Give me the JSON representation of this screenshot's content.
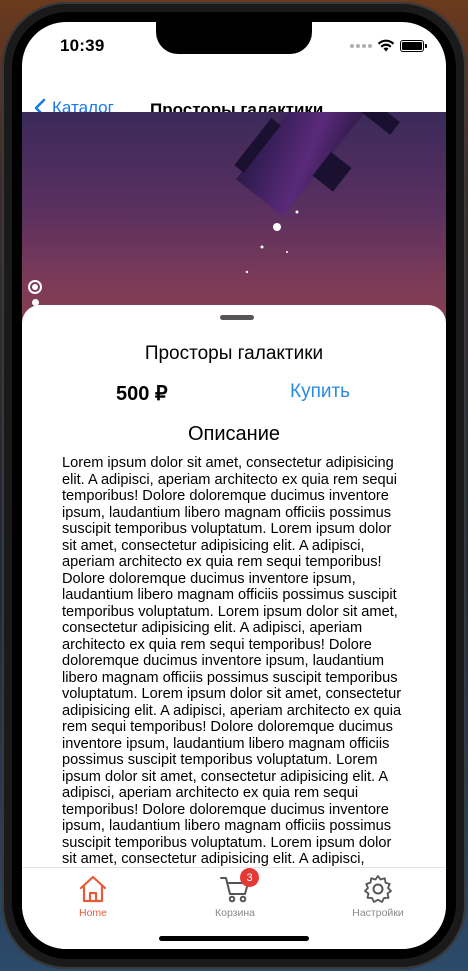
{
  "status": {
    "time": "10:39"
  },
  "nav": {
    "back_label": "Каталог",
    "title": "Просторы галактики"
  },
  "product": {
    "title": "Просторы галактики",
    "price": "500 ₽",
    "buy_label": "Купить",
    "description_heading": "Описание",
    "description": "Lorem ipsum dolor sit amet, consectetur adipisicing elit. A adipisci, aperiam architecto ex quia rem sequi temporibus! Dolore doloremque ducimus inventore ipsum, laudantium libero magnam officiis possimus suscipit temporibus voluptatum. Lorem ipsum dolor sit amet, consectetur adipisicing elit. A adipisci, aperiam architecto ex quia rem sequi temporibus! Dolore doloremque ducimus inventore ipsum, laudantium libero magnam officiis possimus suscipit temporibus voluptatum. Lorem ipsum dolor sit amet, consectetur adipisicing elit. A adipisci, aperiam architecto ex quia rem sequi temporibus! Dolore doloremque ducimus inventore ipsum, laudantium libero magnam officiis possimus suscipit temporibus voluptatum. Lorem ipsum dolor sit amet, consectetur adipisicing elit. A adipisci, aperiam architecto ex quia rem sequi temporibus! Dolore doloremque ducimus inventore ipsum, laudantium libero magnam officiis possimus suscipit temporibus voluptatum. Lorem ipsum dolor sit amet, consectetur adipisicing elit. A adipisci, aperiam architecto ex quia rem sequi temporibus! Dolore doloremque ducimus inventore ipsum, laudantium libero magnam officiis possimus suscipit temporibus voluptatum. Lorem ipsum dolor sit amet, consectetur adipisicing elit. A adipisci,"
  },
  "tabs": [
    {
      "label": "Home",
      "icon": "home-icon",
      "active": true
    },
    {
      "label": "Корзина",
      "icon": "cart-icon",
      "badge": "3"
    },
    {
      "label": "Настройки",
      "icon": "gear-icon"
    }
  ],
  "colors": {
    "accent": "#1a7ae8",
    "active_tab": "#e85a3a",
    "badge": "#e53935"
  }
}
